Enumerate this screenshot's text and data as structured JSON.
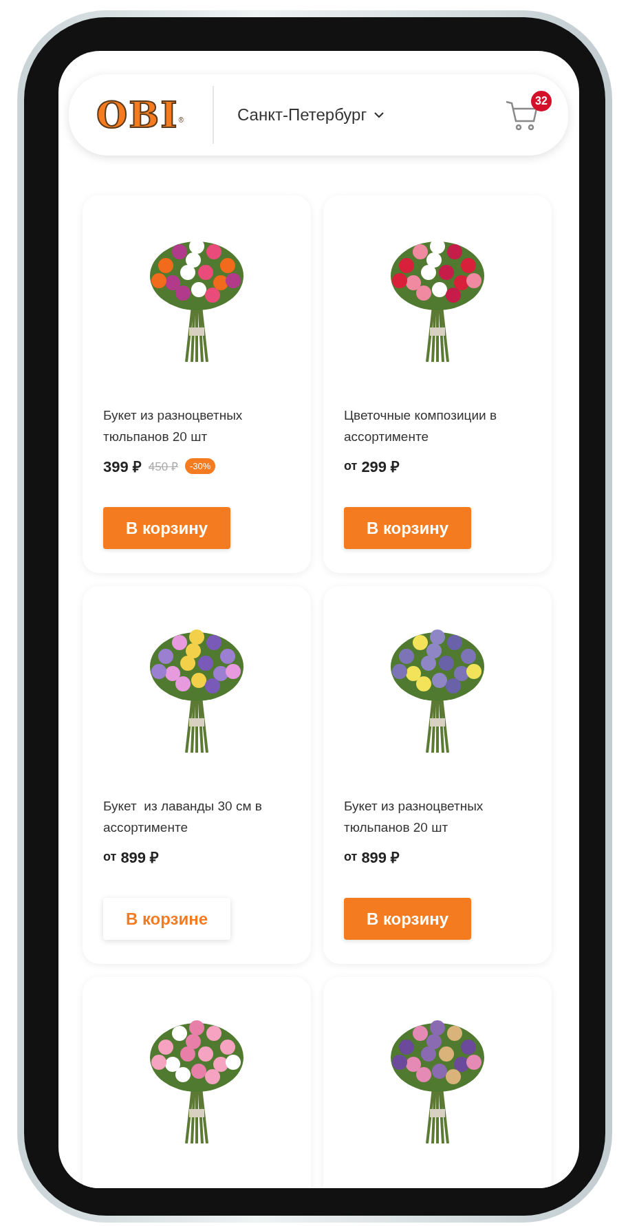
{
  "header": {
    "logo": {
      "text": "OBI",
      "mark": "®"
    },
    "city": "Санкт-Петербург",
    "cart_count": "32"
  },
  "products": [
    {
      "kind": "product",
      "title": "Букет из разноцветных тюльпанов 20 шт",
      "price": "399 ₽",
      "old_price": "450 ₽",
      "discount": "-30%",
      "button": "В корзину",
      "in_cart": false
    },
    {
      "kind": "product",
      "title": "Цветочные композиции в ассортименте",
      "prefix": "от",
      "price": "299 ₽",
      "button": "В корзину",
      "in_cart": false
    },
    {
      "kind": "product",
      "title": "Букет  из лаванды 30 см в ассортименте",
      "prefix": "от",
      "price": "899 ₽",
      "button": "В корзине",
      "in_cart": true
    },
    {
      "kind": "product",
      "title": "Букет из разноцветных тюльпанов 20 шт",
      "prefix": "от",
      "price": "899 ₽",
      "button": "В корзину",
      "in_cart": false
    },
    {
      "kind": "image_only"
    },
    {
      "kind": "image_only"
    }
  ]
}
